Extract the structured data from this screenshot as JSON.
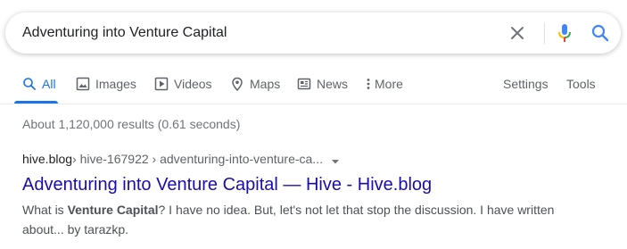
{
  "search": {
    "query": "Adventuring into Venture Capital"
  },
  "icons": {
    "clear": "close-icon",
    "mic": "microphone-icon",
    "search": "search-icon",
    "colors": {
      "mic_blue": "#4285f4",
      "mic_red": "#ea4335",
      "mic_yellow": "#fbbc04",
      "mic_green": "#34a853",
      "search_blue": "#4285f4",
      "active_tab": "#1a73e8",
      "link": "#1a0dab"
    }
  },
  "tabs": {
    "items": [
      {
        "label": "All",
        "icon": "search-icon",
        "active": true
      },
      {
        "label": "Images",
        "icon": "image-icon"
      },
      {
        "label": "Videos",
        "icon": "play-icon"
      },
      {
        "label": "Maps",
        "icon": "map-pin-icon"
      },
      {
        "label": "News",
        "icon": "news-icon"
      },
      {
        "label": "More",
        "icon": "more-vertical-icon"
      }
    ],
    "settings": "Settings",
    "tools": "Tools"
  },
  "stats": {
    "text": "About 1,120,000 results (0.61 seconds)"
  },
  "result": {
    "domain": "hive.blog",
    "path": " › hive-167922 › adventuring-into-venture-ca...",
    "title": "Adventuring into Venture Capital — Hive - Hive.blog",
    "snippet_pre": "What is ",
    "snippet_bold": "Venture Capital",
    "snippet_post": "? I have no idea. But, let's not let that stop the discussion. I have written about... by tarazkp."
  }
}
